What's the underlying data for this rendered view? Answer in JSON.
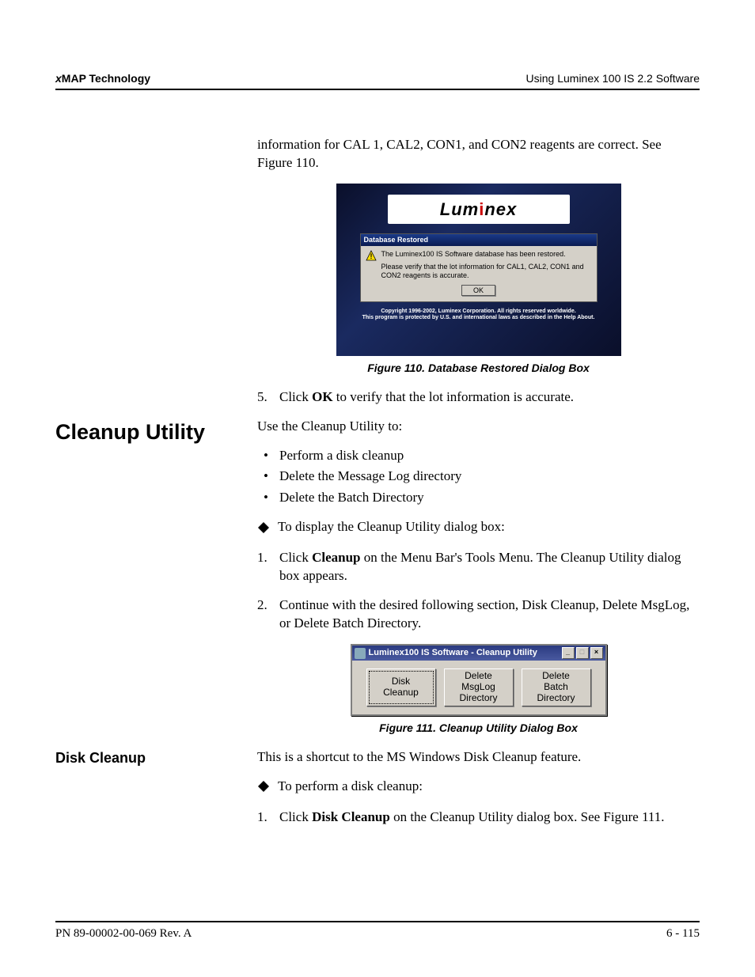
{
  "header": {
    "tech_prefix_char": "x",
    "tech": "MAP Technology",
    "right": "Using Luminex 100 IS 2.2 Software"
  },
  "intro_para_fragment": "information for CAL 1, CAL2, CON1, and CON2 reagents are correct. See Figure 110.",
  "fig110": {
    "caption": "Figure 110.  Database Restored Dialog Box",
    "logo_prefix": "Lum",
    "logo_dot_i": "i",
    "logo_suffix": "nex",
    "title": "Database Restored",
    "line1": "The Luminex100 IS Software database has been restored.",
    "line2": "Please verify that the lot information for CAL1, CAL2, CON1 and CON2 reagents is accurate.",
    "ok_label": "OK",
    "copyright1": "Copyright 1996-2002, Luminex Corporation. All rights reserved worldwide.",
    "copyright2": "This program is protected by U.S. and international laws as described in the Help About."
  },
  "step5": {
    "num": "5.",
    "pre": "Click ",
    "bold": "OK",
    "post": " to verify that the lot information is accurate."
  },
  "cleanup": {
    "heading": "Cleanup Utility",
    "intro": "Use the Cleanup Utility to:",
    "bullets": [
      "Perform a disk cleanup",
      "Delete the Message Log directory",
      "Delete the Batch Directory"
    ],
    "diamond_line": "To display the Cleanup Utility dialog box:",
    "step1": {
      "num": "1.",
      "pre": "Click ",
      "bold": "Cleanup",
      "post": " on the Menu Bar's Tools Menu. The Cleanup Utility dialog box appears."
    },
    "step2": {
      "num": "2.",
      "text": "Continue with the desired following section, Disk Cleanup, Delete MsgLog, or Delete Batch Directory."
    }
  },
  "fig111": {
    "caption": "Figure 111.  Cleanup Utility Dialog Box",
    "title": "Luminex100 IS Software - Cleanup Utility",
    "btn_min": "_",
    "btn_max": "□",
    "btn_close": "×",
    "buttons": [
      "Disk\nCleanup",
      "Delete\nMsgLog\nDirectory",
      "Delete\nBatch\nDirectory"
    ]
  },
  "disk_cleanup": {
    "heading": "Disk Cleanup",
    "intro": "This is a shortcut to the MS Windows Disk Cleanup feature.",
    "diamond_line": "To perform a disk cleanup:",
    "step1": {
      "num": "1.",
      "pre": "Click ",
      "bold": "Disk Cleanup",
      "post": " on the Cleanup Utility dialog box. See Figure 111."
    }
  },
  "footer": {
    "left": "PN 89-00002-00-069 Rev. A",
    "right": "6 - 115"
  }
}
